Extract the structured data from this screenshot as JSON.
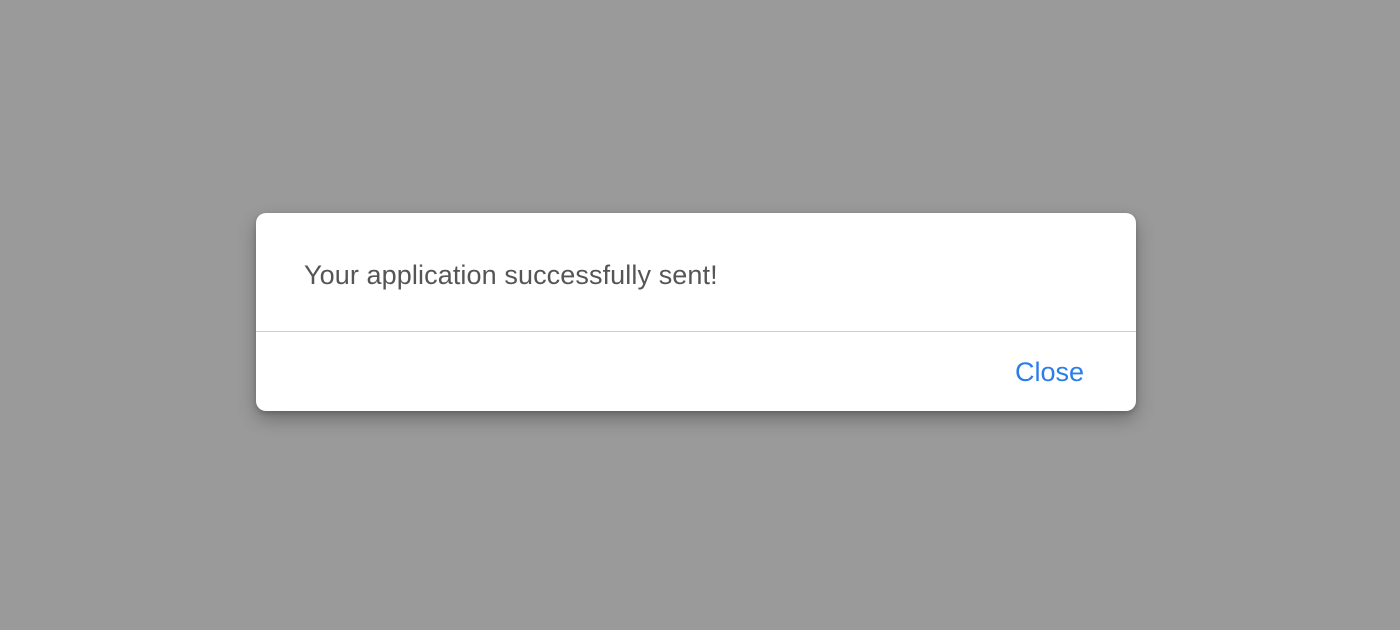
{
  "dialog": {
    "message": "Your application successfully sent!",
    "close_label": "Close"
  },
  "colors": {
    "backdrop": "#9a9a9a",
    "dialog_background": "#ffffff",
    "message_text": "#555555",
    "accent": "#2b7de9",
    "divider": "#cfcfcf"
  }
}
